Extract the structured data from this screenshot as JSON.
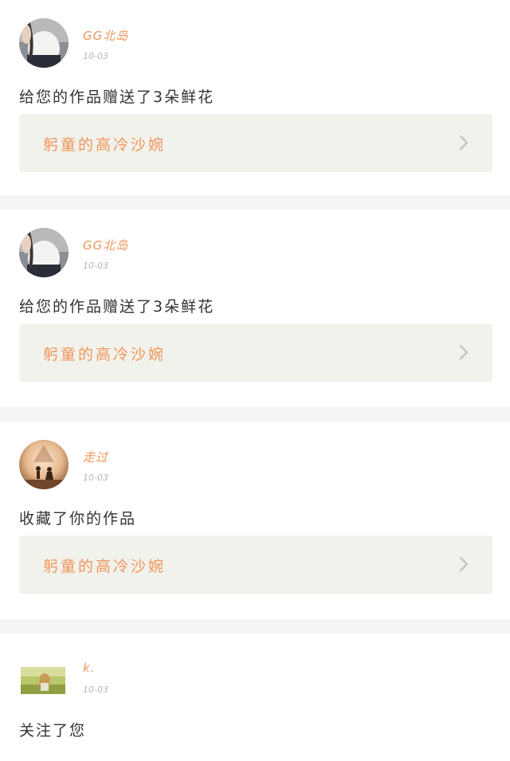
{
  "notifications": [
    {
      "username": "GG北岛",
      "date": "10-03",
      "action": "给您的作品赠送了3朵鲜花",
      "work_title": "躬童的高冷沙婉",
      "avatar": "woman-white-top-avatar"
    },
    {
      "username": "GG北岛",
      "date": "10-03",
      "action": "给您的作品赠送了3朵鲜花",
      "work_title": "躬童的高冷沙婉",
      "avatar": "woman-white-top-avatar"
    },
    {
      "username": "走过",
      "date": "10-03",
      "action": "收藏了你的作品",
      "work_title": "躬童的高冷沙婉",
      "avatar": "silhouette-sunset-avatar"
    },
    {
      "username": "k.",
      "date": "10-03",
      "action": "关注了您",
      "avatar": "girl-field-avatar"
    }
  ],
  "colors": {
    "accent": "#f0955a",
    "card_bg": "#ffffff",
    "page_bg": "#f5f5f5",
    "work_bg": "#f2f2ec"
  }
}
